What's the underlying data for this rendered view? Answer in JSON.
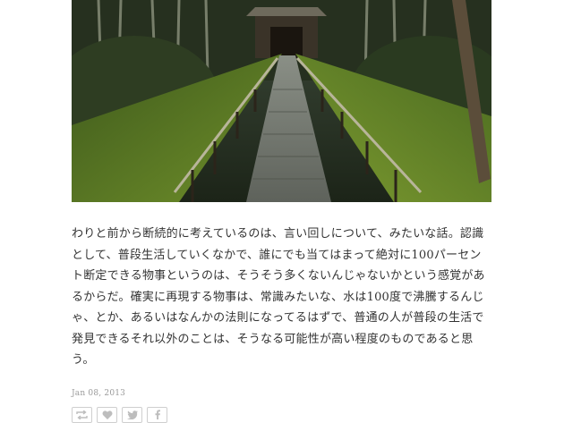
{
  "post": {
    "text": "わりと前から断続的に考えているのは、言い回しについて、みたいな話。認識として、普段生活していくなかで、誰にでも当てはまって絶対に100パーセント断定できる物事というのは、そうそう多くないんじゃないかという感覚があるからだ。確実に再現する物事は、常識みたいな、水は100度で沸騰するんじゃ、とか、あるいはなんかの法則になってるはずで、普通の人が普段の生活で発見できるそれ以外のことは、そうなる可能性が高い程度のものであると思う。",
    "date": "Jan 08, 2013"
  },
  "actions": [
    {
      "name": "reblog",
      "icon": "reblog-icon"
    },
    {
      "name": "like",
      "icon": "heart-icon"
    },
    {
      "name": "tweet",
      "icon": "twitter-bird-icon"
    },
    {
      "name": "facebook-share",
      "icon": "facebook-icon"
    }
  ],
  "colors": {
    "text": "#333333",
    "date": "#9a9a9a",
    "button_border": "#cfcfcf",
    "icon": "#bdbdbd"
  }
}
